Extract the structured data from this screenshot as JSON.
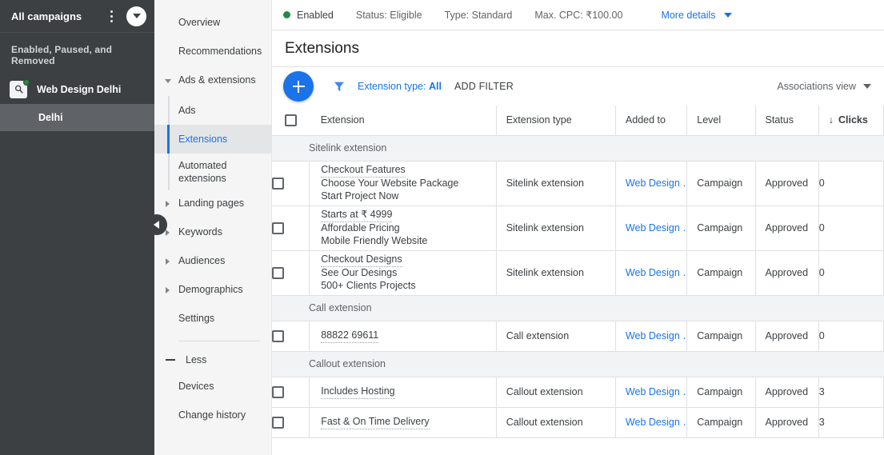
{
  "sidebar": {
    "title": "All campaigns",
    "kebab_icon": "more-vert-icon",
    "expand_icon": "chevron-down-icon",
    "filter_label": "Enabled, Paused, and Removed",
    "campaign": {
      "name": "Web Design Delhi",
      "icon": "search-campaign-icon",
      "status_color": "#1e8e3e"
    },
    "adgroup": {
      "name": "Delhi"
    },
    "collapse_icon": "chevron-left-icon"
  },
  "nav": {
    "items": [
      {
        "label": "Overview",
        "type": "item",
        "expandable": false,
        "active": false
      },
      {
        "label": "Recommendations",
        "type": "item",
        "expandable": false,
        "active": false
      },
      {
        "label": "Ads & extensions",
        "type": "item",
        "expandable": true,
        "expanded": true,
        "active": false
      }
    ],
    "sub_items": [
      {
        "label": "Ads",
        "active": false
      },
      {
        "label": "Extensions",
        "active": true
      },
      {
        "label": "Automated extensions",
        "active": false
      }
    ],
    "items2": [
      {
        "label": "Landing pages",
        "expandable": true
      },
      {
        "label": "Keywords",
        "expandable": true
      },
      {
        "label": "Audiences",
        "expandable": true
      },
      {
        "label": "Demographics",
        "expandable": true
      },
      {
        "label": "Settings",
        "expandable": false
      }
    ],
    "less_label": "Less",
    "less_icon": "minus-icon",
    "items3": [
      {
        "label": "Devices"
      },
      {
        "label": "Change history"
      }
    ]
  },
  "status_bar": {
    "state": "Enabled",
    "status": "Status: Eligible",
    "type": "Type: Standard",
    "max_cpc": "Max. CPC: ₹100.00",
    "more_details": "More details"
  },
  "page": {
    "title": "Extensions"
  },
  "toolbar": {
    "add_icon": "plus-icon",
    "filter_icon": "filter-funnel-icon",
    "filter_chip_label": "Extension type:",
    "filter_chip_value": "All",
    "add_filter": "ADD FILTER",
    "view_label": "Associations view"
  },
  "table": {
    "columns": [
      "Extension",
      "Extension type",
      "Added to",
      "Level",
      "Status",
      "Clicks"
    ],
    "sort_column": "Clicks",
    "sort_icon": "↓",
    "groups": [
      {
        "label": "Sitelink extension",
        "rows": [
          {
            "lines": [
              "Checkout Features",
              "Choose Your Website Package",
              "Start Project Now"
            ],
            "type": "Sitelink extension",
            "added_to": "Web Design …",
            "level": "Campaign",
            "status": "Approved",
            "clicks": "0"
          },
          {
            "lines": [
              "Starts at ₹ 4999",
              "Affordable Pricing",
              "Mobile Friendly Website"
            ],
            "type": "Sitelink extension",
            "added_to": "Web Design …",
            "level": "Campaign",
            "status": "Approved",
            "clicks": "0"
          },
          {
            "lines": [
              "Checkout Designs",
              "See Our Desings",
              "500+ Clients Projects"
            ],
            "type": "Sitelink extension",
            "added_to": "Web Design …",
            "level": "Campaign",
            "status": "Approved",
            "clicks": "0"
          }
        ]
      },
      {
        "label": "Call extension",
        "rows": [
          {
            "lines": [
              "88822 69611"
            ],
            "type": "Call extension",
            "added_to": "Web Design …",
            "level": "Campaign",
            "status": "Approved",
            "clicks": "0"
          }
        ]
      },
      {
        "label": "Callout extension",
        "rows": [
          {
            "lines": [
              "Includes Hosting"
            ],
            "type": "Callout extension",
            "added_to": "Web Design …",
            "level": "Campaign",
            "status": "Approved",
            "clicks": "3"
          },
          {
            "lines": [
              "Fast & On Time Delivery"
            ],
            "type": "Callout extension",
            "added_to": "Web Design …",
            "level": "Campaign",
            "status": "Approved",
            "clicks": "3"
          }
        ]
      }
    ]
  },
  "colors": {
    "accent": "#1a73e8",
    "sidebar": "#3c4043",
    "sidebar_active": "#5f6368",
    "green": "#1e8e3e"
  }
}
